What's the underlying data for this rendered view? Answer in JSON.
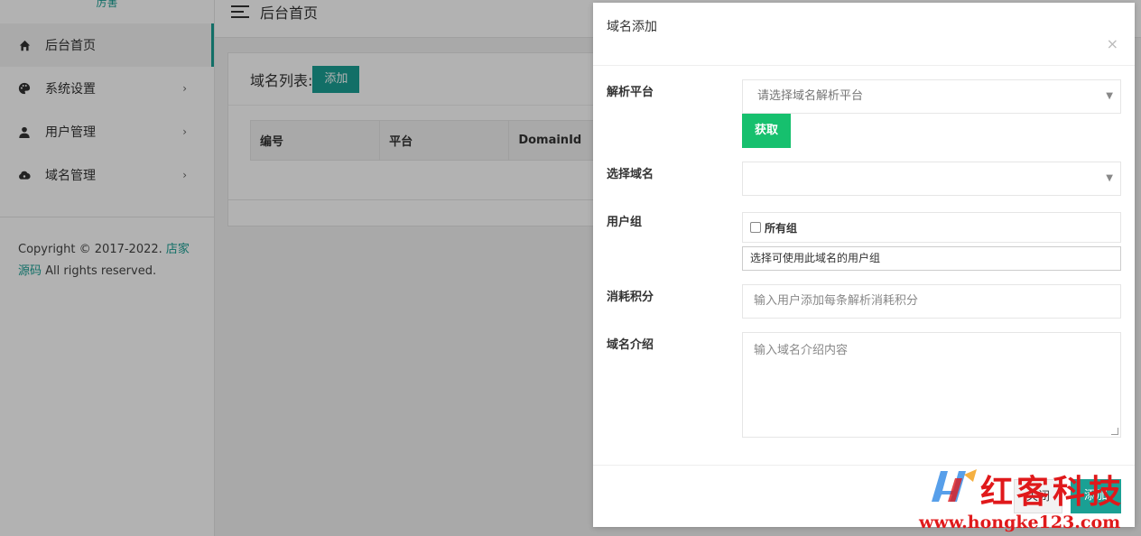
{
  "sidebar": {
    "logo_alt": "厉害",
    "items": [
      {
        "label": "后台首页",
        "icon": "home-icon",
        "active": true
      },
      {
        "label": "系统设置",
        "icon": "palette-icon",
        "arrow": "›"
      },
      {
        "label": "用户管理",
        "icon": "user-icon",
        "arrow": "›"
      },
      {
        "label": "域名管理",
        "icon": "cloud-icon",
        "arrow": "›"
      }
    ],
    "copyright_prefix": "Copyright © 2017-2022.",
    "copyright_link": "店家源码",
    "copyright_suffix": "All rights reserved."
  },
  "topbar": {
    "title": "后台首页",
    "menu_icon": "hamburger-icon"
  },
  "main": {
    "list_title": "域名列表:",
    "add_label": "添加",
    "columns": [
      "编号",
      "平台",
      "DomainId"
    ]
  },
  "modal": {
    "title": "域名添加",
    "close_glyph": "×",
    "fields": {
      "platform_label": "解析平台",
      "platform_placeholder": "请选择域名解析平台",
      "fetch_label": "获取",
      "domain_label": "选择域名",
      "domain_value": "",
      "group_label": "用户组",
      "group_option": "所有组",
      "group_hint": "选择可使用此域名的用户组",
      "points_label": "消耗积分",
      "points_placeholder": "输入用户添加每条解析消耗积分",
      "intro_label": "域名介绍",
      "intro_placeholder": "输入域名介绍内容"
    },
    "close_button": "关闭",
    "submit_button": "添加"
  },
  "watermark": {
    "title": "红客科技",
    "url": "www.hongke123.com"
  },
  "colors": {
    "accent": "#1aa094",
    "fetch": "#16c06e",
    "watermark": "#e0191b"
  }
}
